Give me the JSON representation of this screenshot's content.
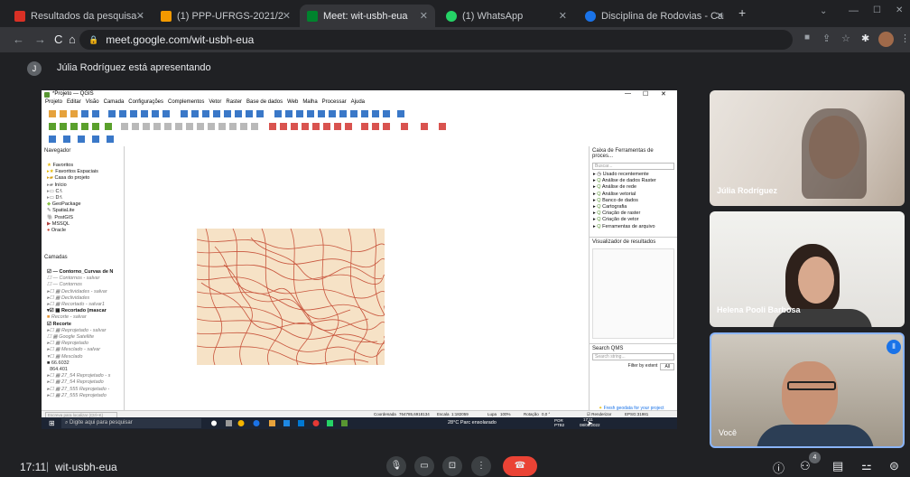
{
  "browser": {
    "tabs": [
      {
        "label": "Resultados da pesquisa - daniel.c",
        "color": "#d93025"
      },
      {
        "label": "(1) PPP-UFRGS-2021/2",
        "color": "#f29900"
      },
      {
        "label": "Meet: wit-usbh-eua",
        "color": "#00832d"
      },
      {
        "label": "(1) WhatsApp",
        "color": "#25d366"
      },
      {
        "label": "Disciplina de Rodovias - Canva",
        "color": "#1a73e8"
      }
    ],
    "new_tab": "+",
    "url": "meet.google.com/wit-usbh-eua"
  },
  "presenting": {
    "initial": "J",
    "text": "Júlia Rodríguez está apresentando"
  },
  "qgis": {
    "title": "*Projeto — QGIS",
    "menu": [
      "Projeto",
      "Editar",
      "Visão",
      "Camada",
      "Configurações",
      "Complementos",
      "Vetor",
      "Raster",
      "Base de dados",
      "Web",
      "Malha",
      "Processar",
      "Ajuda"
    ],
    "browser_title": "Navegador",
    "browser_items": [
      "Favoritos",
      "Favoritos Espaciais",
      "Casa do projeto",
      "Início",
      "C:\\",
      "D:\\",
      "GeoPackage",
      "SpatiaLite",
      "PostGIS",
      "MSSQL",
      "Oracle"
    ],
    "layers_title": "Camadas",
    "layers": [
      "Contorno_Curvas de N",
      "Contornos - salvar",
      "Contornos",
      "Declividades - salvar",
      "Declividades",
      "Recortado - salvar1",
      "Recortado (mascar",
      "Recorte - salvar",
      "Recorte",
      "Reprojetado - salvar",
      "Google Satellite",
      "Reprojetado",
      "Mesclado - salvar",
      "Mesclado",
      "66.6032",
      "864.401",
      "27_54 Reprojetado - s",
      "27_54 Reprojetado",
      "27_555 Reprojetado -",
      "27_555 Reprojetado"
    ],
    "toolbox_title": "Caixa de Ferramentas de proces...",
    "toolbox_search": "Buscar...",
    "toolbox_items": [
      "Usado recentemente",
      "Análise de dados Raster",
      "Análise de rede",
      "Análise vetorial",
      "Banco de dados",
      "Cartografia",
      "Criação de raster",
      "Criação de vetor",
      "Ferramentas de arquivo"
    ],
    "results_title": "Visualizador de resultados",
    "qms_title": "Search QMS",
    "qms_search": "Search string...",
    "qms_filter": "Filter by extent",
    "qms_filter_val": "All",
    "qms_footer": "Fresh geodata for your project",
    "locator": "Escreva para localizar (Ctrl+K)",
    "status": {
      "coord_label": "Coordenada",
      "coord": "764785,6918134",
      "scale_label": "Escala",
      "scale": "1:182059",
      "zoom_label": "Lupa",
      "zoom": "100%",
      "rot_label": "Rotação",
      "rot": "0,0 °",
      "render": "Renderizar",
      "epsg": "EPSG:31981"
    }
  },
  "windows_taskbar": {
    "search": "Digite aqui para pesquisar",
    "weather": "28°C Parc ensolarado",
    "lang": "POR\nPTB2",
    "time": "17:11",
    "date": "08/02/2022"
  },
  "participants": [
    {
      "name": "Júlia Rodríguez"
    },
    {
      "name": "Helena Pooli Barbosa"
    },
    {
      "name": "Você"
    }
  ],
  "meeting": {
    "time": "17:11",
    "separator": "|",
    "code": "wit-usbh-eua",
    "people_count": "4"
  },
  "colors": {
    "meet_red": "#ea4335",
    "contour": "#c8553d",
    "map_bg": "#f6e2c6",
    "active_speaker": "#8ab4f8"
  }
}
